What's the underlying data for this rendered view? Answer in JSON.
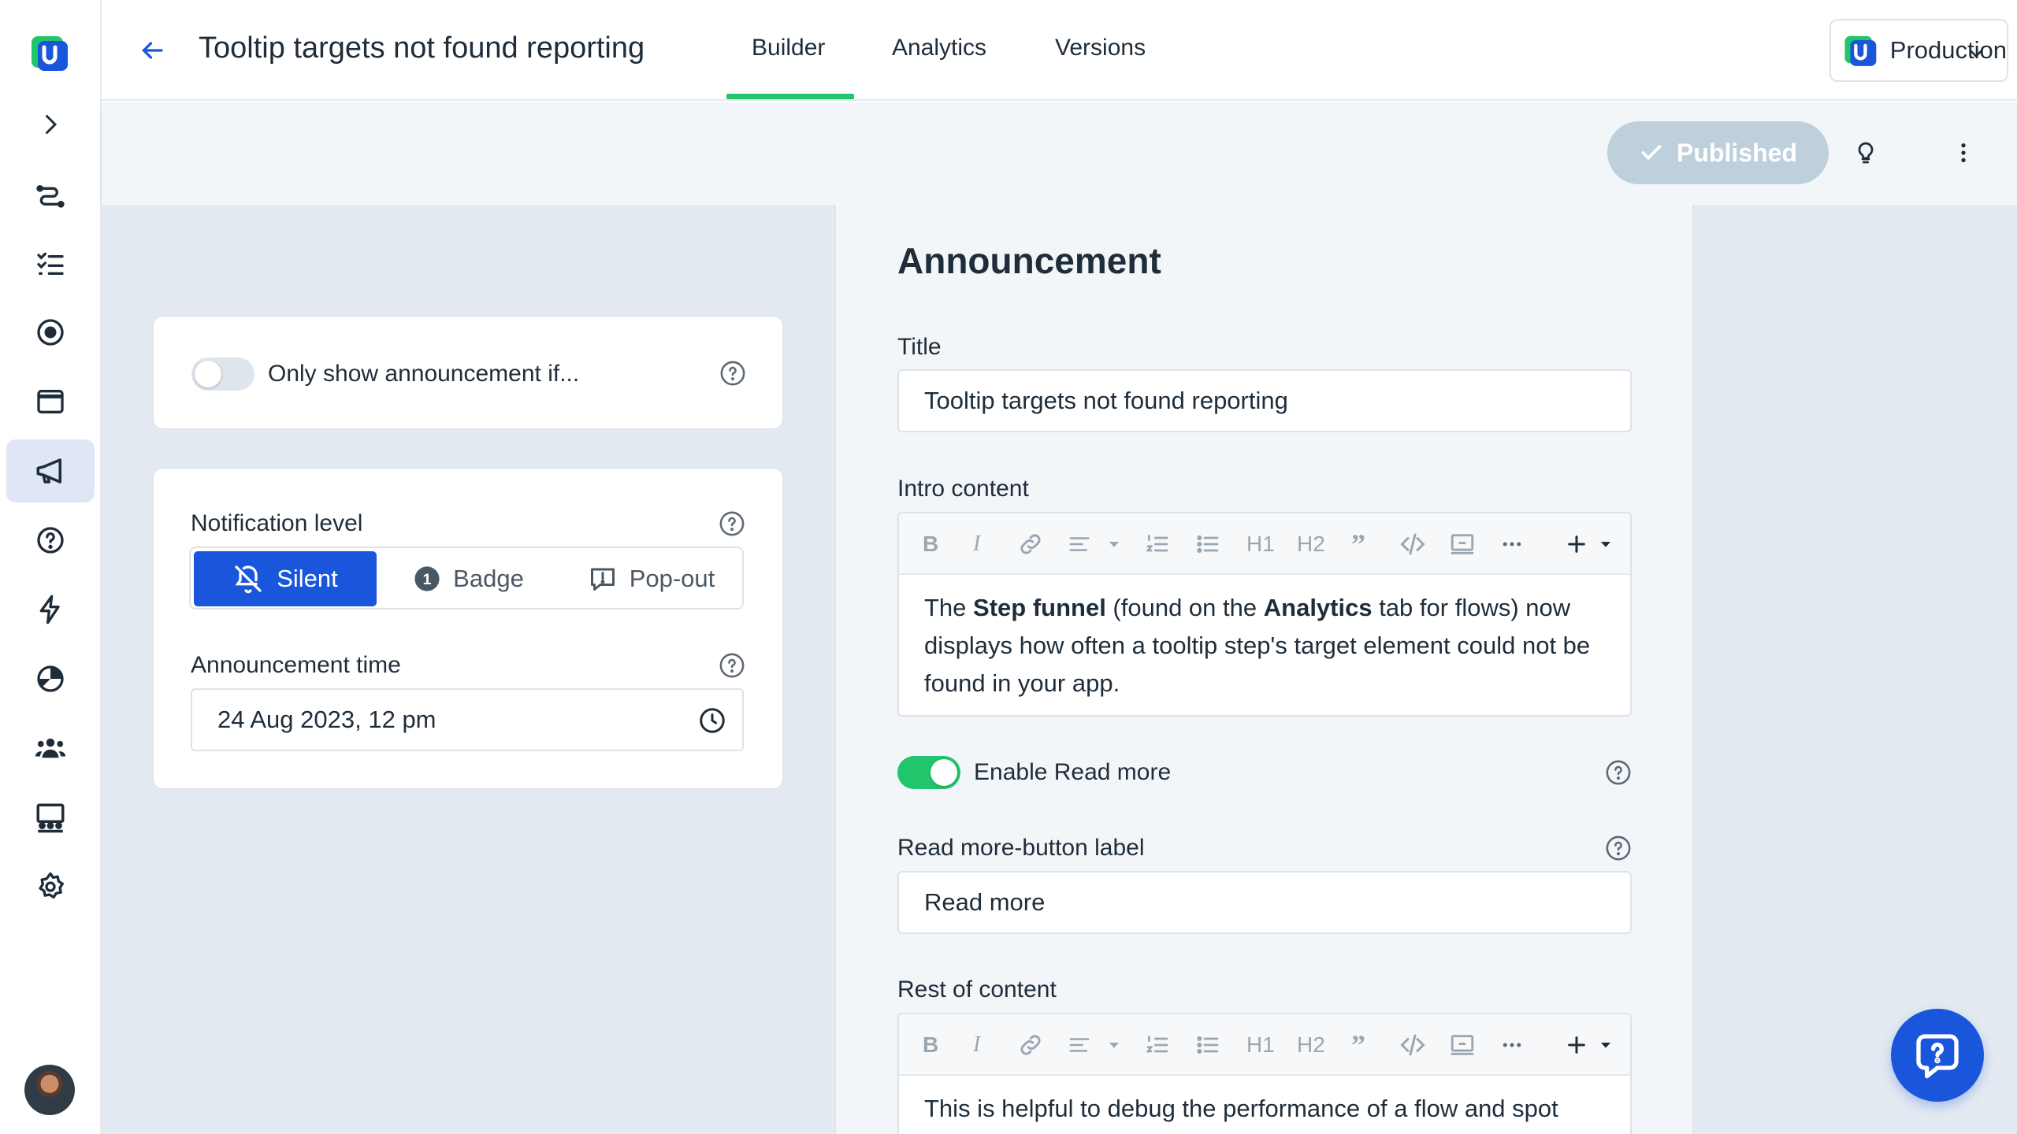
{
  "header": {
    "title": "Tooltip targets not found reporting",
    "tabs": [
      {
        "label": "Builder",
        "active": true
      },
      {
        "label": "Analytics",
        "active": false
      },
      {
        "label": "Versions",
        "active": false
      }
    ],
    "environment": "Production"
  },
  "actions": {
    "status_label": "Published"
  },
  "sidebar": {
    "items": [
      {
        "icon": "chevron-right-icon"
      },
      {
        "icon": "flows-icon"
      },
      {
        "icon": "checklist-icon"
      },
      {
        "icon": "target-icon"
      },
      {
        "icon": "window-icon"
      },
      {
        "icon": "megaphone-icon",
        "active": true
      },
      {
        "icon": "help-circle-icon"
      },
      {
        "icon": "lightning-icon"
      },
      {
        "icon": "analytics-icon"
      },
      {
        "icon": "users-icon"
      },
      {
        "icon": "audience-icon"
      },
      {
        "icon": "settings-icon"
      }
    ]
  },
  "settings": {
    "conditional_label": "Only show announcement if...",
    "conditional_enabled": false,
    "notification_level_label": "Notification level",
    "notification_options": [
      {
        "label": "Silent",
        "icon": "bell-off-icon",
        "active": true
      },
      {
        "label": "Badge",
        "icon": "badge-icon",
        "badge_number": "1",
        "active": false
      },
      {
        "label": "Pop-out",
        "icon": "popout-icon",
        "active": false
      }
    ],
    "announcement_time_label": "Announcement time",
    "announcement_time_value": "24 Aug 2023, 12 pm"
  },
  "editor": {
    "heading": "Announcement",
    "title_label": "Title",
    "title_value": "Tooltip targets not found reporting",
    "intro_label": "Intro content",
    "intro_parts": {
      "p1": "The ",
      "b1": "Step funnel",
      "p2": " (found on the ",
      "b2": "Analytics",
      "p3": " tab for flows) now displays how often a tooltip step's target element could not be found in your app."
    },
    "read_more_toggle_label": "Enable Read more",
    "read_more_enabled": true,
    "read_more_button_label_title": "Read more-button label",
    "read_more_button_label_value": "Read more",
    "rest_label": "Rest of content",
    "rest_text": "This is helpful to debug the performance of a flow and spot",
    "toolbar": [
      "B",
      "I",
      "link",
      "align",
      "ordered-list",
      "bullet-list",
      "H1",
      "H2",
      "quote",
      "code",
      "embed",
      "more",
      "+"
    ]
  },
  "colors": {
    "accent": "#1a56db",
    "success": "#21c56b",
    "canvas": "#e3eaf1"
  }
}
